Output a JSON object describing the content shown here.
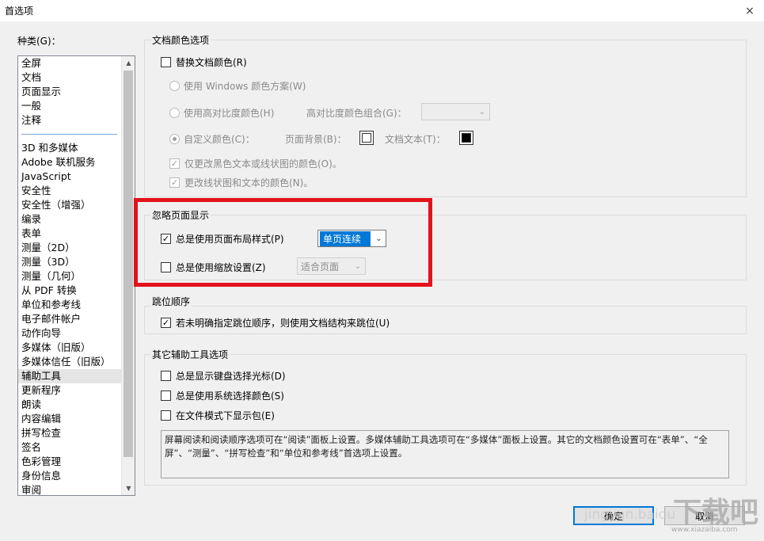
{
  "window": {
    "title": "首选项",
    "close_icon": "×"
  },
  "categories": {
    "label": "种类(G)：",
    "top_items": [
      "全屏",
      "文档",
      "页面显示",
      "一般",
      "注释"
    ],
    "items": [
      "3D 和多媒体",
      "Adobe 联机服务",
      "JavaScript",
      "安全性",
      "安全性（增强）",
      "编录",
      "表单",
      "测量（2D）",
      "测量（3D）",
      "测量（几何）",
      "从 PDF 转换",
      "单位和参考线",
      "电子邮件帐户",
      "动作向导",
      "多媒体（旧版）",
      "多媒体信任（旧版）",
      "辅助工具",
      "更新程序",
      "朗读",
      "内容编辑",
      "拼写检查",
      "签名",
      "色彩管理",
      "身份信息",
      "审阅"
    ],
    "selected": "辅助工具"
  },
  "doc_colors": {
    "title": "文档颜色选项",
    "replace": "替换文档颜色(R)",
    "use_windows": "使用 Windows 颜色方案(W)",
    "use_high_contrast": "使用高对比度颜色(H)",
    "high_contrast_combo": "高对比度颜色组合(G)：",
    "custom": "自定义颜色(C)：",
    "page_bg": "页面背景(B)：",
    "doc_text": "文档文本(T)：",
    "only_black_text": "仅更改黑色文本或线状图的颜色(O)。",
    "change_line": "更改线状图和文本的颜色(N)。",
    "colors": {
      "page_bg": "#ffffff",
      "doc_text": "#000000"
    }
  },
  "page_display": {
    "title": "忽略页面显示",
    "layout_label": "总是使用页面布局样式(P)",
    "layout_value": "单页连续",
    "zoom_label": "总是使用缩放设置(Z)",
    "zoom_value": "适合页面"
  },
  "tab_order": {
    "title": "跳位顺序",
    "label": "若未明确指定跳位顺序，则使用文档结构来跳位(U)"
  },
  "other": {
    "title": "其它辅助工具选项",
    "keyboard_cursor": "总是显示键盘选择光标(D)",
    "system_color": "总是使用系统选择颜色(S)",
    "show_bag": "在文件模式下显示包(E)",
    "note": "屏幕阅读和阅读顺序选项可在“阅读”面板上设置。多媒体辅助工具选项可在“多媒体”面板上设置。其它的文档颜色设置可在“表单”、“全屏”、“测量”、“拼写检查”和“单位和参考线”首选项上设置。"
  },
  "buttons": {
    "ok": "确定",
    "cancel": "取消"
  },
  "watermark": {
    "left": "jingyan.baidu",
    "right": "下载吧",
    "url": "www.xiazaiba.com"
  }
}
